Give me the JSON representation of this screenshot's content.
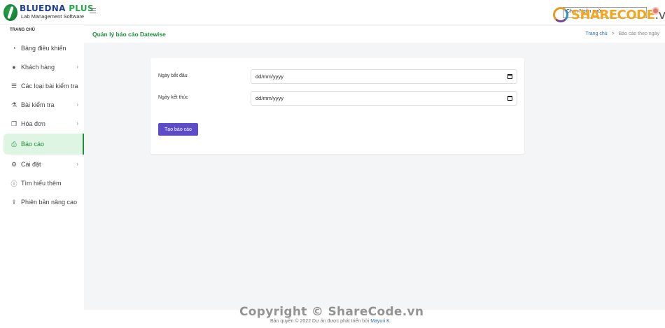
{
  "brand": {
    "name_main": "BLUEDNA",
    "name_plus": "PLUS",
    "subtitle": "Lab Management Software"
  },
  "topbar": {
    "language_select": "Chọn Ngôn ngữ",
    "watermark_logo_text": "SHARECODE",
    "watermark_logo_suffix": ".vn"
  },
  "sidebar": {
    "section_title": "TRANG CHỦ",
    "items": [
      {
        "label": "Bảng điều khiển",
        "icon": "dashboard-icon",
        "has_children": false
      },
      {
        "label": "Khách hàng",
        "icon": "user-icon",
        "has_children": true
      },
      {
        "label": "Các loại bài kiểm tra",
        "icon": "list-icon",
        "has_children": false
      },
      {
        "label": "Bài kiểm tra",
        "icon": "flask-icon",
        "has_children": true
      },
      {
        "label": "Hóa đơn",
        "icon": "invoice-icon",
        "has_children": true
      },
      {
        "label": "Báo cáo",
        "icon": "print-icon",
        "has_children": false,
        "active": true
      },
      {
        "label": "Cài đặt",
        "icon": "gear-icon",
        "has_children": true
      },
      {
        "label": "Tìm hiểu thêm",
        "icon": "info-icon",
        "has_children": false
      },
      {
        "label": "Phiên bản nâng cao",
        "icon": "upload-icon",
        "has_children": false
      }
    ]
  },
  "header": {
    "title": "Quản lý báo cáo Datewise",
    "breadcrumb_home": "Trang chủ",
    "breadcrumb_sep": ">",
    "breadcrumb_current": "Báo cáo theo ngày"
  },
  "form": {
    "start_label": "Ngày bắt đầu",
    "start_value": "dd/mm/yyyy",
    "end_label": "Ngày kết thúc",
    "end_value": "dd/mm/yyyy",
    "submit_label": "Tạo báo cáo"
  },
  "footer": {
    "watermark": "Copyright © ShareCode.vn",
    "copyright": "Bản quyền © 2022 Dự án được phát triển bởi",
    "author": "Mayuri K"
  },
  "colors": {
    "accent_green": "#1d8f3c",
    "button_purple": "#5d4bc7",
    "link_blue": "#2e6db4"
  }
}
